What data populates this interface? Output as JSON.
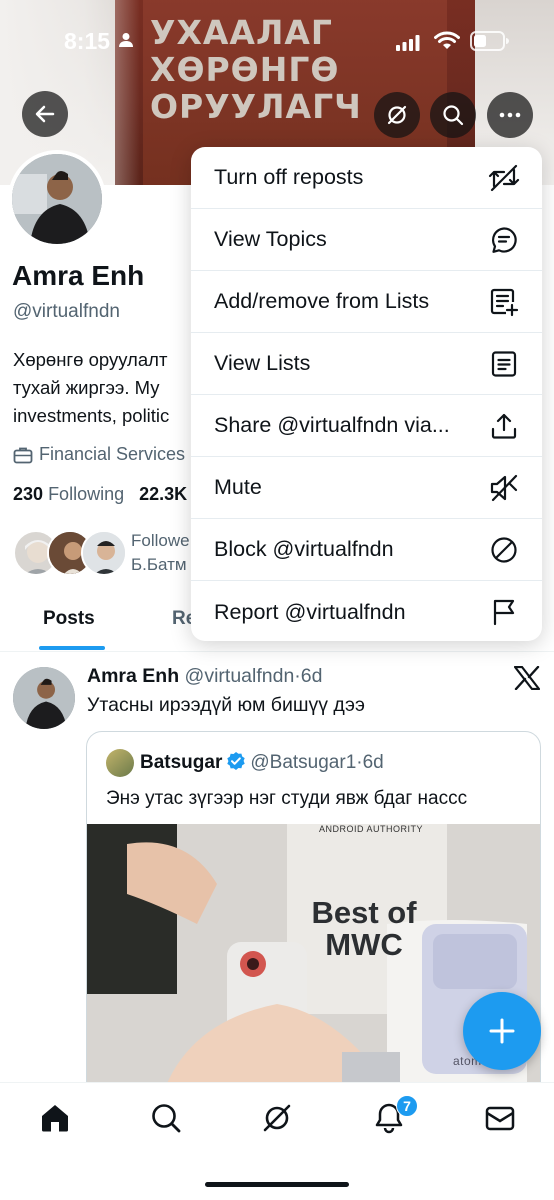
{
  "status_bar": {
    "time": "8:15"
  },
  "banner": {
    "cover_text": "УХААЛАГ\nХӨРӨНГӨ\nОРУУЛАГЧ"
  },
  "profile": {
    "name": "Amra Enh",
    "handle": "@virtualfndn",
    "bio_line1": "Хөрөнгө оруулалт",
    "bio_line2": "тухай жиргээ. Му",
    "bio_line3": "investments, politic",
    "category": "Financial Services",
    "following_count": "230",
    "following_label": "Following",
    "followers_count": "22.3K",
    "followed_by_line1": "Followe",
    "followed_by_line2": "Б.Батм"
  },
  "tabs": [
    {
      "label": "Posts"
    },
    {
      "label": "Re"
    }
  ],
  "menu": {
    "items": [
      {
        "label": "Turn off reposts",
        "icon": "repost-off-icon"
      },
      {
        "label": "View Topics",
        "icon": "topics-icon"
      },
      {
        "label": "Add/remove from Lists",
        "icon": "list-add-icon"
      },
      {
        "label": "View Lists",
        "icon": "lists-icon"
      },
      {
        "label": "Share @virtualfndn via...",
        "icon": "share-icon"
      },
      {
        "label": "Mute",
        "icon": "mute-icon"
      },
      {
        "label": "Block @virtualfndn",
        "icon": "block-icon"
      },
      {
        "label": "Report @virtualfndn",
        "icon": "flag-icon"
      }
    ]
  },
  "post": {
    "author": "Amra Enh",
    "handle": "@virtualfndn",
    "time": "6d",
    "text": "Утасны ирээдүй юм бишүү дээ",
    "quote": {
      "author": "Batsugar",
      "handle": "@Batsugar1",
      "time": "6d",
      "text": "Энэ утас зүгээр нэг студи явж бдаг нассс",
      "media_sign_line1": "Best of",
      "media_sign_line2": "MWC",
      "media_brand": "ANDROID AUTHORITY",
      "media_phone_label": "atom"
    }
  },
  "bottom_nav": {
    "notifications_badge": "7"
  },
  "colors": {
    "accent": "#1d9bf0",
    "text": "#0f1419",
    "secondary": "#536471"
  }
}
